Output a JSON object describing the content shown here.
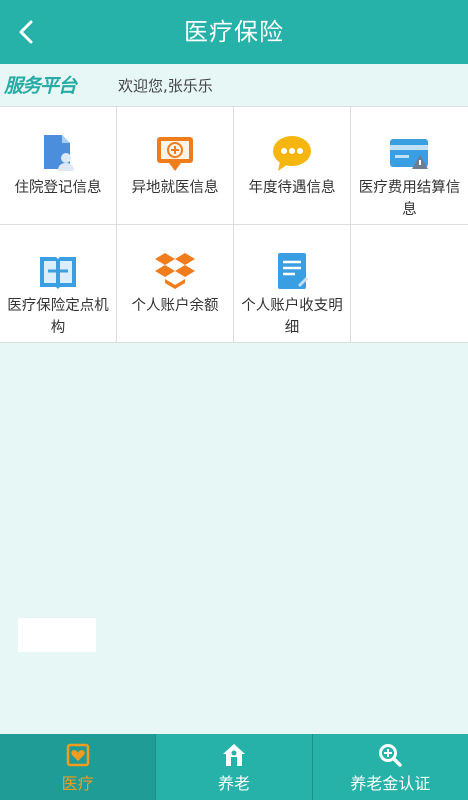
{
  "header": {
    "title": "医疗保险"
  },
  "welcome": {
    "brand": "服务平台",
    "text": "欢迎您,张乐乐"
  },
  "grid": {
    "items": [
      {
        "label": "住院登记信息",
        "icon": "document-person-icon"
      },
      {
        "label": "异地就医信息",
        "icon": "medical-chat-icon"
      },
      {
        "label": "年度待遇信息",
        "icon": "speech-bubble-icon"
      },
      {
        "label": "医疗费用结算信息",
        "icon": "card-warning-icon"
      },
      {
        "label": "医疗保险定点机构",
        "icon": "book-icon"
      },
      {
        "label": "个人账户余额",
        "icon": "dropbox-icon"
      },
      {
        "label": "个人账户收支明细",
        "icon": "notepad-icon"
      }
    ]
  },
  "tabs": [
    {
      "label": "医疗",
      "icon": "heart-card-icon",
      "active": true
    },
    {
      "label": "养老",
      "icon": "house-icon",
      "active": false
    },
    {
      "label": "养老金认证",
      "icon": "search-icon",
      "active": false
    }
  ],
  "colors": {
    "primary": "#26b1a9",
    "active_tab": "#f39c1f",
    "background": "#e6f7f6"
  }
}
